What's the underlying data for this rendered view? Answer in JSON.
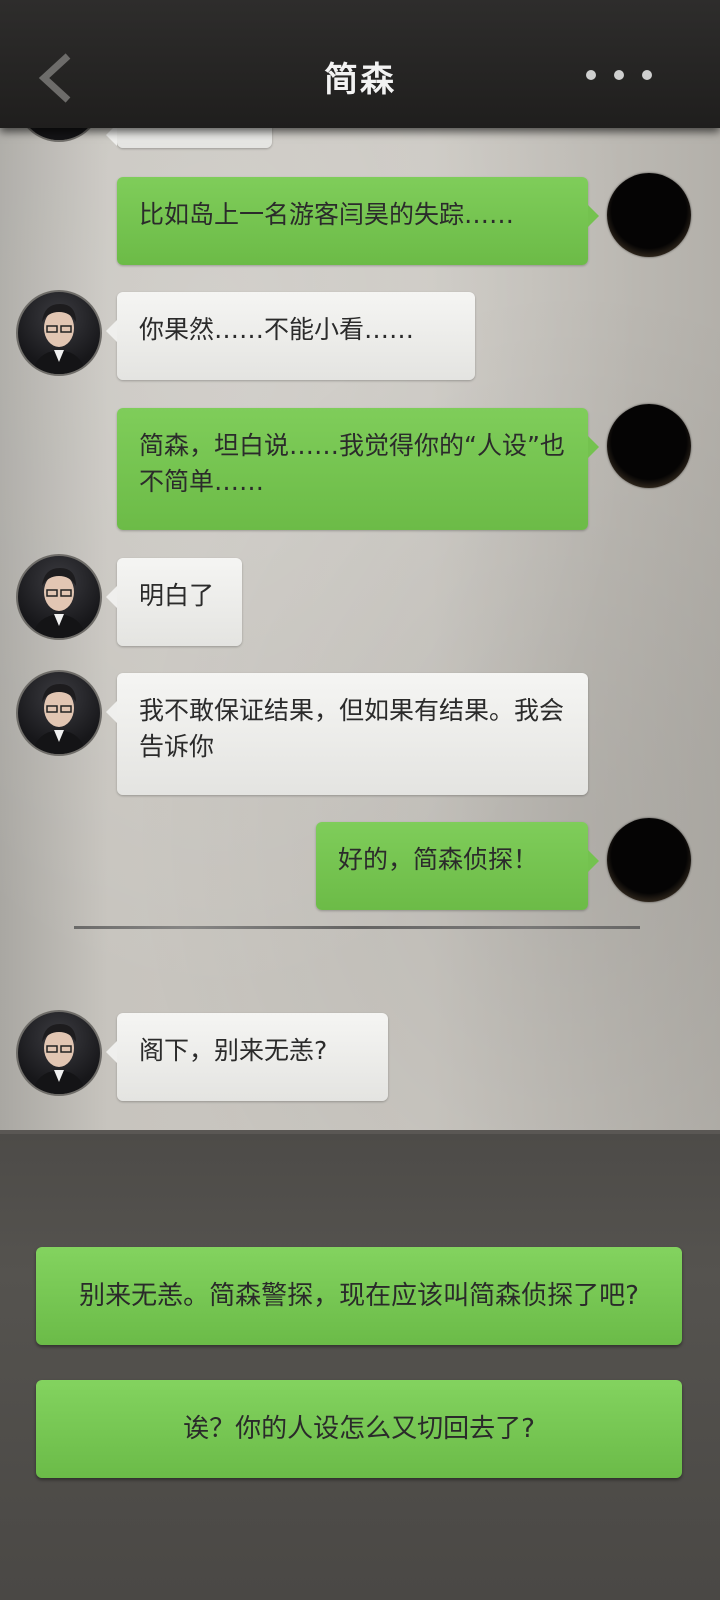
{
  "header": {
    "title": "简森"
  },
  "messages": [
    {
      "text": "",
      "side": "left"
    },
    {
      "text": "比如岛上一名游客闫昊的失踪……",
      "side": "right"
    },
    {
      "text": "你果然……不能小看……",
      "side": "left"
    },
    {
      "text": "简森，坦白说……我觉得你的“人设”也不简单……",
      "side": "right"
    },
    {
      "text": "明白了",
      "side": "left"
    },
    {
      "text": "我不敢保证结果，但如果有结果。我会告诉你",
      "side": "left"
    },
    {
      "text": "好的，简森侦探！",
      "side": "right"
    },
    {
      "text": "阁下，别来无恙?",
      "side": "left"
    }
  ],
  "choices": [
    "别来无恙。简森警探，现在应该叫简森侦探了吧?",
    "诶？你的人设怎么又切回去了?"
  ],
  "icons": {
    "back": "chevron-left-icon",
    "more": "more-dots-icon"
  }
}
